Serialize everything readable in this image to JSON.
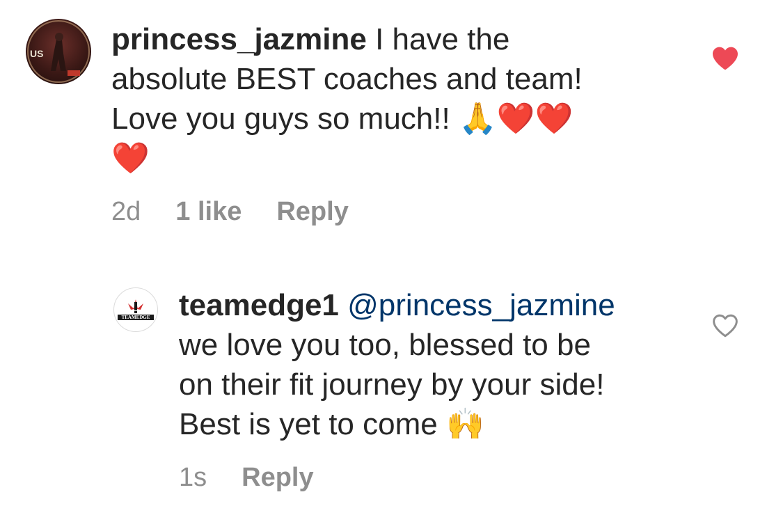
{
  "comments": [
    {
      "username": "princess_jazmine",
      "text_line1": " I have the",
      "text_line2": "absolute BEST coaches and team!",
      "text_line3": "Love you guys so much!! ",
      "emoji_line3": "🙏❤️❤️",
      "emoji_line4": "❤️",
      "time": "2d",
      "likes": "1 like",
      "reply_label": "Reply",
      "liked": true,
      "like_color": "#ed4956"
    },
    {
      "username": "teamedge1",
      "mention": "@princess_jazmine",
      "text_line2": "we love you too, blessed to be",
      "text_line3": "on their fit journey by your side!",
      "text_line4": "Best is yet to come ",
      "emoji_line4": "🙌",
      "time": "1s",
      "reply_label": "Reply",
      "liked": false,
      "avatar_text": "TEAMEDGE",
      "mention_color": "#003569"
    }
  ]
}
